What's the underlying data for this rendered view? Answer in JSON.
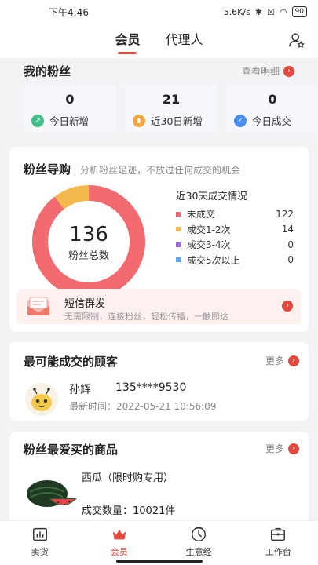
{
  "status_bar": {
    "time": "下午4:46",
    "net_speed": "5.6K/s",
    "battery": "90"
  },
  "top_nav": {
    "tabs": [
      {
        "label": "会员",
        "active": true
      },
      {
        "label": "代理人",
        "active": false
      }
    ],
    "user_icon": "user-settings-icon"
  },
  "my_fans": {
    "title": "我的粉丝",
    "more_label": "查看明细",
    "cards": [
      {
        "value": "0",
        "label": "今日新增",
        "icon": "trend-icon",
        "color": "#3fbf8a"
      },
      {
        "value": "21",
        "label": "近30日新增",
        "icon": "bar-chart-icon",
        "color": "#f3a43b"
      },
      {
        "value": "0",
        "label": "今日成交",
        "icon": "check-icon",
        "color": "#4a8ef0"
      }
    ]
  },
  "fan_guide": {
    "title": "粉丝导购",
    "subtitle": "分析粉丝足迹，不放过任何成交的机会",
    "total": "136",
    "total_label": "粉丝总数",
    "legend_title": "近30天成交情况",
    "legend": [
      {
        "label": "未成交",
        "value": "122",
        "color": "#f06a6f"
      },
      {
        "label": "成交1-2次",
        "value": "14",
        "color": "#f5b84c"
      },
      {
        "label": "成交3-4次",
        "value": "0",
        "color": "#9b6ff0"
      },
      {
        "label": "成交5次以上",
        "value": "0",
        "color": "#5aa8f0"
      }
    ],
    "sms": {
      "title": "短信群发",
      "subtitle": "无需限制，连接粉丝，轻松传播，一触即达"
    }
  },
  "likely_customer": {
    "title": "最可能成交的顾客",
    "more_label": "更多",
    "name": "孙辉",
    "phone": "135****9530",
    "time": "最新时间：2022-05-21 10:56:09"
  },
  "favorite_products": {
    "title": "粉丝最爱买的商品",
    "more_label": "更多",
    "product_name": "西瓜（限时购专用）",
    "quantity": "成交数量：10021件"
  },
  "bottom_nav": [
    {
      "label": "卖货",
      "icon": "sales-icon",
      "active": false
    },
    {
      "label": "会员",
      "icon": "crown-icon",
      "active": true
    },
    {
      "label": "生意经",
      "icon": "business-icon",
      "active": false
    },
    {
      "label": "工作台",
      "icon": "workbench-icon",
      "active": false
    }
  ]
}
